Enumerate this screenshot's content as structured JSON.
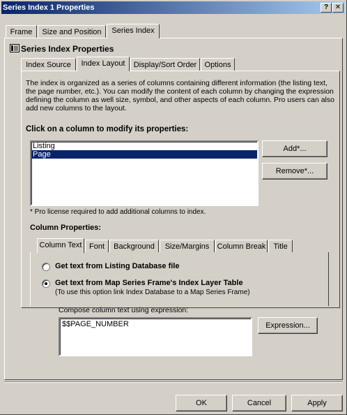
{
  "window": {
    "title": "Series Index 1 Properties",
    "help_btn": "?",
    "close_btn": "✕"
  },
  "outer_tabs": [
    "Frame",
    "Size and Position",
    "Series Index"
  ],
  "section_title": "Series Index Properties",
  "inner_tabs": [
    "Index Source",
    "Index Layout",
    "Display/Sort Order",
    "Options"
  ],
  "description": "The index is organized as a series of columns containing different information (the listing text, the page number, etc.).  You can modify the content of each column by changing the expression defining the column as well size, symbol, and other aspects of each column.  Pro users can also add new columns to the layout.",
  "columns_heading": "Click on a column to modify its properties:",
  "columns": [
    {
      "label": "Listing",
      "selected": false
    },
    {
      "label": "Page",
      "selected": true
    }
  ],
  "add_button": "Add*...",
  "remove_button": "Remove*...",
  "pro_note": "* Pro license required to add additional columns to index.",
  "column_properties_heading": "Column Properties:",
  "prop_tabs": [
    "Column Text",
    "Font",
    "Background",
    "Size/Margins",
    "Column Break",
    "Title"
  ],
  "radio_listing_db": "Get text from Listing Database file",
  "radio_map_series": "Get text from Map Series Frame's Index Layer Table",
  "map_series_hint": "(To use this option link Index Database to a Map Series Frame)",
  "compose_label": "Compose column text using expression:",
  "expression_value": "$$PAGE_NUMBER",
  "expression_button": "Expression...",
  "ok_button": "OK",
  "cancel_button": "Cancel",
  "apply_button": "Apply",
  "selected_radio": "map_series"
}
